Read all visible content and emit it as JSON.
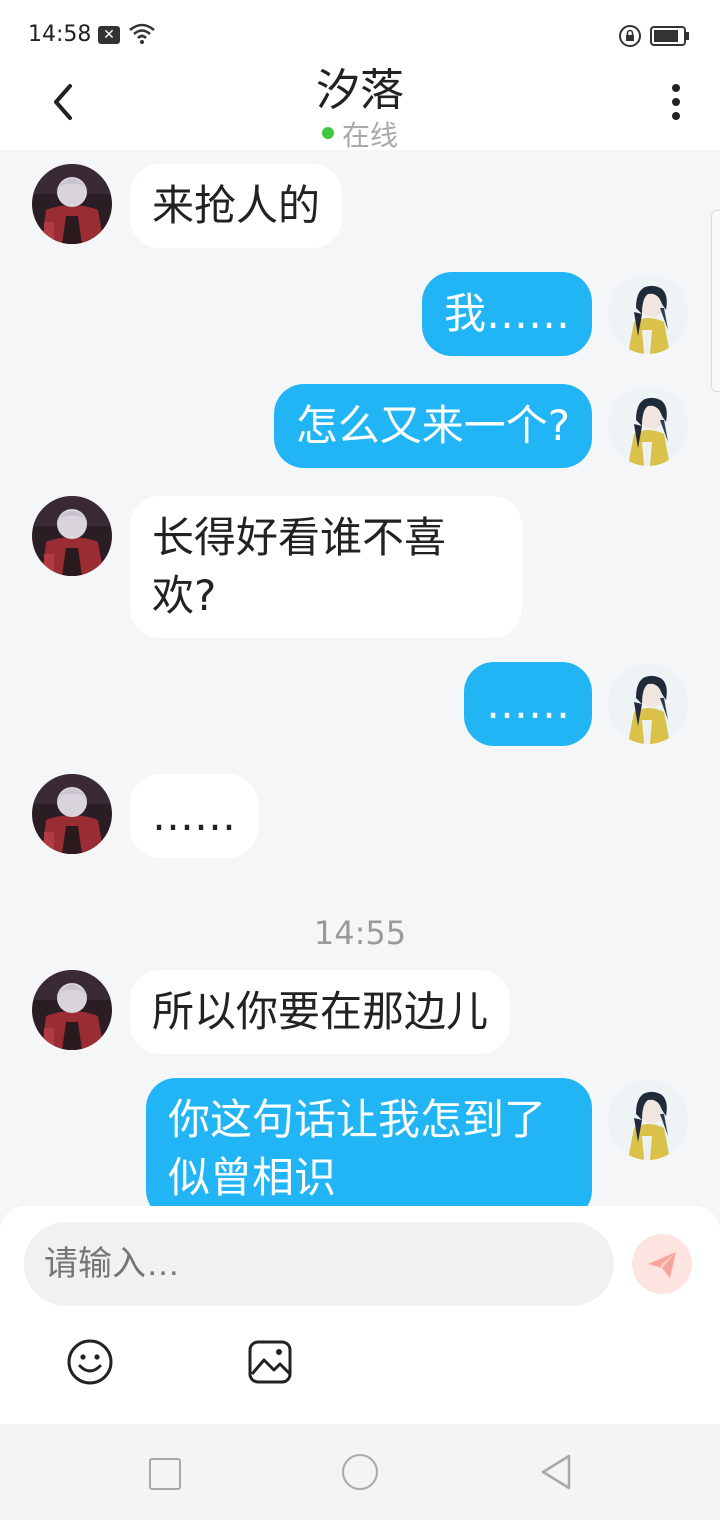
{
  "status_bar": {
    "time": "14:58",
    "notification_badge": "✕"
  },
  "header": {
    "title": "汐落",
    "status": "在线"
  },
  "colors": {
    "outgoing_bubble": "#22b5f6",
    "incoming_bubble": "#ffffff",
    "online_dot": "#3ec83e",
    "background": "#f5f6f8"
  },
  "messages": [
    {
      "side": "in",
      "text": "来抢人的"
    },
    {
      "side": "out",
      "text": "我……"
    },
    {
      "side": "out",
      "text": "怎么又来一个?"
    },
    {
      "side": "in",
      "text": "长得好看谁不喜欢?"
    },
    {
      "side": "out",
      "text": "……"
    },
    {
      "side": "in",
      "text": "……"
    },
    {
      "side": "in",
      "text": "所以你要在那边儿"
    },
    {
      "side": "out",
      "text": "你这句话让我怎到了似曾相识"
    }
  ],
  "time_separator": "14:55",
  "composer": {
    "placeholder": "请输入…"
  },
  "icons": {
    "back": "chevron-left-icon",
    "more": "more-vertical-icon",
    "send": "paper-plane-icon",
    "emoji": "smiley-icon",
    "image": "image-icon"
  }
}
